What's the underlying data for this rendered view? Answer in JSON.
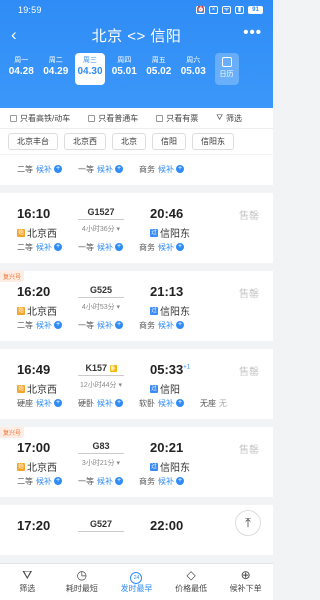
{
  "status": {
    "time": "19:59",
    "battery": "91"
  },
  "header": {
    "title": "北京 <> 信阳"
  },
  "dates": [
    {
      "weekday": "周一",
      "date": "04.28",
      "active": false
    },
    {
      "weekday": "周二",
      "date": "04.29",
      "active": false
    },
    {
      "weekday": "周三",
      "date": "04.30",
      "active": true
    },
    {
      "weekday": "周四",
      "date": "05.01",
      "active": false
    },
    {
      "weekday": "周五",
      "date": "05.02",
      "active": false
    },
    {
      "weekday": "周六",
      "date": "05.03",
      "active": false
    }
  ],
  "calendar_label": "日历",
  "filters": {
    "gaotie": "只看高铁/动车",
    "putong": "只看普通车",
    "youpiao": "只看有票",
    "filter": "筛选"
  },
  "stations": [
    "北京丰台",
    "北京西",
    "北京",
    "信阳",
    "信阳东"
  ],
  "first_seats": [
    {
      "type": "二等",
      "status": "候补"
    },
    {
      "type": "一等",
      "status": "候补"
    },
    {
      "type": "商务",
      "status": "候补"
    }
  ],
  "trains": [
    {
      "badge": "",
      "dep_time": "16:10",
      "train_no": "G1527",
      "wo": "",
      "arr_time": "20:46",
      "next_day": "",
      "duration": "4小时36分",
      "dep_station": "北京西",
      "arr_station": "信阳东",
      "arr_tag": "过",
      "status": "售罄",
      "seats": [
        {
          "type": "二等",
          "status": "候补"
        },
        {
          "type": "一等",
          "status": "候补"
        },
        {
          "type": "商务",
          "status": "候补"
        }
      ]
    },
    {
      "badge": "复兴号",
      "dep_time": "16:20",
      "train_no": "G525",
      "wo": "",
      "arr_time": "21:13",
      "next_day": "",
      "duration": "4小时53分",
      "dep_station": "北京西",
      "arr_station": "信阳东",
      "arr_tag": "过",
      "status": "售罄",
      "seats": [
        {
          "type": "二等",
          "status": "候补"
        },
        {
          "type": "一等",
          "status": "候补"
        },
        {
          "type": "商务",
          "status": "候补"
        }
      ]
    },
    {
      "badge": "",
      "dep_time": "16:49",
      "train_no": "K157",
      "wo": "卧",
      "arr_time": "05:33",
      "next_day": "+1",
      "duration": "12小时44分",
      "dep_station": "北京西",
      "arr_station": "信阳",
      "arr_tag": "过",
      "status": "售罄",
      "seats": [
        {
          "type": "硬座",
          "status": "候补"
        },
        {
          "type": "硬卧",
          "status": "候补"
        },
        {
          "type": "软卧",
          "status": "候补"
        },
        {
          "type": "无座",
          "status": "无"
        }
      ]
    },
    {
      "badge": "复兴号",
      "dep_time": "17:00",
      "train_no": "G83",
      "wo": "",
      "arr_time": "20:21",
      "next_day": "",
      "duration": "3小时21分",
      "dep_station": "北京西",
      "arr_station": "信阳东",
      "arr_tag": "过",
      "status": "售罄",
      "seats": [
        {
          "type": "二等",
          "status": "候补"
        },
        {
          "type": "一等",
          "status": "候补"
        },
        {
          "type": "商务",
          "status": "候补"
        }
      ]
    },
    {
      "badge": "",
      "dep_time": "17:20",
      "train_no": "G527",
      "wo": "",
      "arr_time": "22:00",
      "next_day": "",
      "duration": "",
      "dep_station": "",
      "arr_station": "",
      "arr_tag": "",
      "status": "售罄",
      "seats": []
    }
  ],
  "bottom_nav": [
    {
      "label": "筛选",
      "icon": "funnel-icon",
      "active": false
    },
    {
      "label": "耗时最短",
      "icon": "clock-icon",
      "active": false
    },
    {
      "label": "发时最早",
      "icon": "early-icon",
      "active": true
    },
    {
      "label": "价格最低",
      "icon": "price-tag-icon",
      "active": false
    },
    {
      "label": "候补下单",
      "icon": "cart-icon",
      "active": false
    }
  ],
  "colors": {
    "accent": "#2f8cf6",
    "sold_out": "#c8c8c8",
    "fuxing_badge": "#f07132"
  }
}
